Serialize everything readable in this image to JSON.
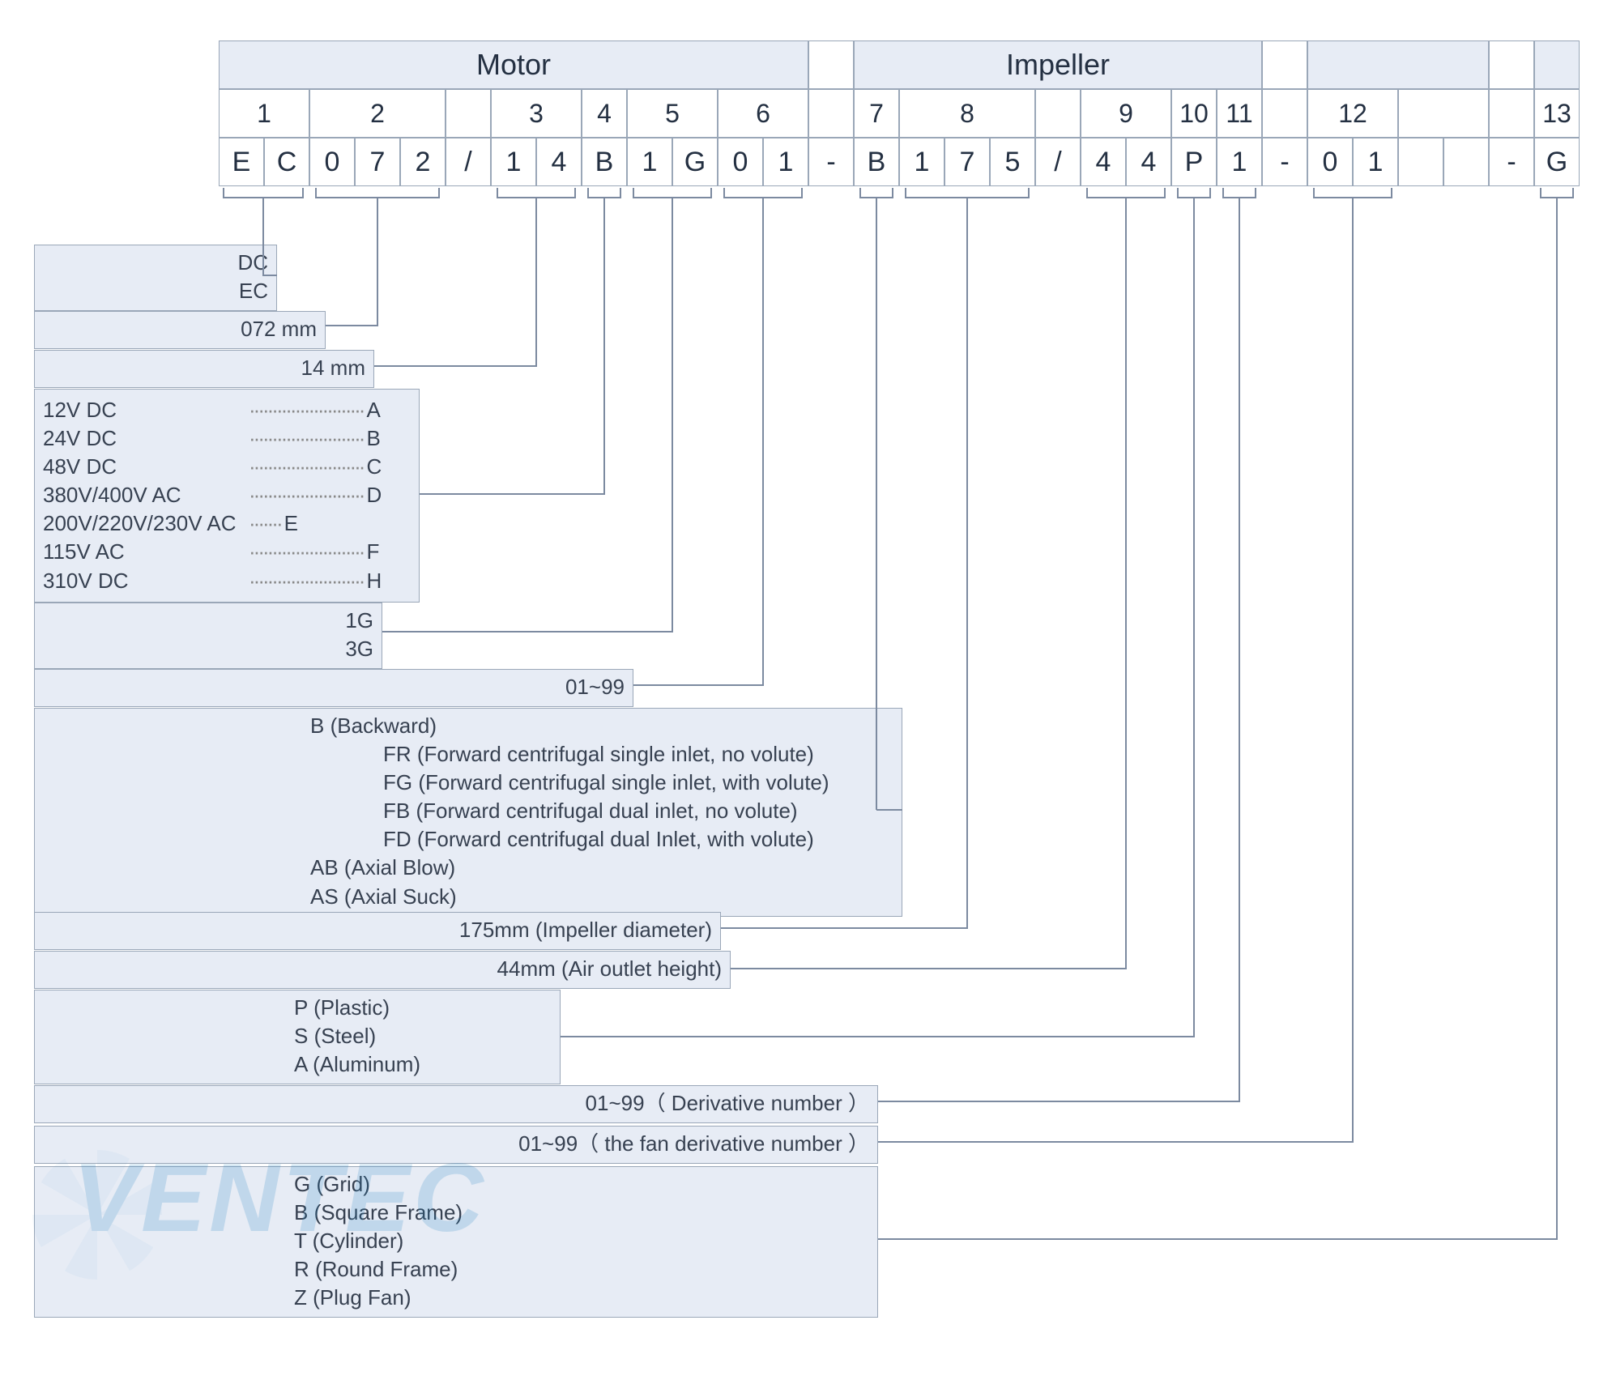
{
  "headers": {
    "motor": "Motor",
    "impeller": "Impeller"
  },
  "positions": [
    "1",
    "2",
    "3",
    "4",
    "5",
    "6",
    "7",
    "8",
    "9",
    "10",
    "11",
    "12",
    "13"
  ],
  "code_cells": [
    "E",
    "C",
    "0",
    "7",
    "2",
    "/",
    "1",
    "4",
    "B",
    "1",
    "G",
    "0",
    "1",
    "-",
    "B",
    "1",
    "7",
    "5",
    "/",
    "4",
    "4",
    "P",
    "1",
    "-",
    "0",
    "1",
    "-",
    "G"
  ],
  "legend": {
    "pos1": [
      "DC",
      "EC"
    ],
    "pos2": "072 mm",
    "pos3": "14 mm",
    "pos4": [
      {
        "label": "12V DC",
        "code": "A"
      },
      {
        "label": "24V DC",
        "code": "B"
      },
      {
        "label": "48V DC",
        "code": "C"
      },
      {
        "label": "380V/400V AC",
        "code": "D"
      },
      {
        "label": "200V/220V/230V AC",
        "code": "E",
        "short": true
      },
      {
        "label": "115V AC",
        "code": "F"
      },
      {
        "label": "310V DC",
        "code": "H"
      }
    ],
    "pos5": [
      "1G",
      "3G"
    ],
    "pos6": "01~99",
    "pos7": {
      "b": "B (Backward)",
      "sub": [
        "FR (Forward centrifugal single inlet, no volute)",
        "FG (Forward centrifugal single inlet, with volute)",
        "FB (Forward centrifugal dual inlet, no volute)",
        "FD (Forward centrifugal dual Inlet, with volute)"
      ],
      "ab": "AB (Axial Blow)",
      "as": "AS (Axial Suck)"
    },
    "pos8": "175mm (Impeller diameter)",
    "pos9": "44mm (Air outlet height)",
    "pos10": [
      "P (Plastic)",
      "S (Steel)",
      "A (Aluminum)"
    ],
    "pos11": "01~99（ Derivative number ）",
    "pos12": "01~99（ the fan derivative number ）",
    "pos13": [
      "G (Grid)",
      "B (Square Frame)",
      "T (Cylinder)",
      "R (Round Frame)",
      "Z (Plug Fan)"
    ]
  },
  "watermark": "VENTEC"
}
